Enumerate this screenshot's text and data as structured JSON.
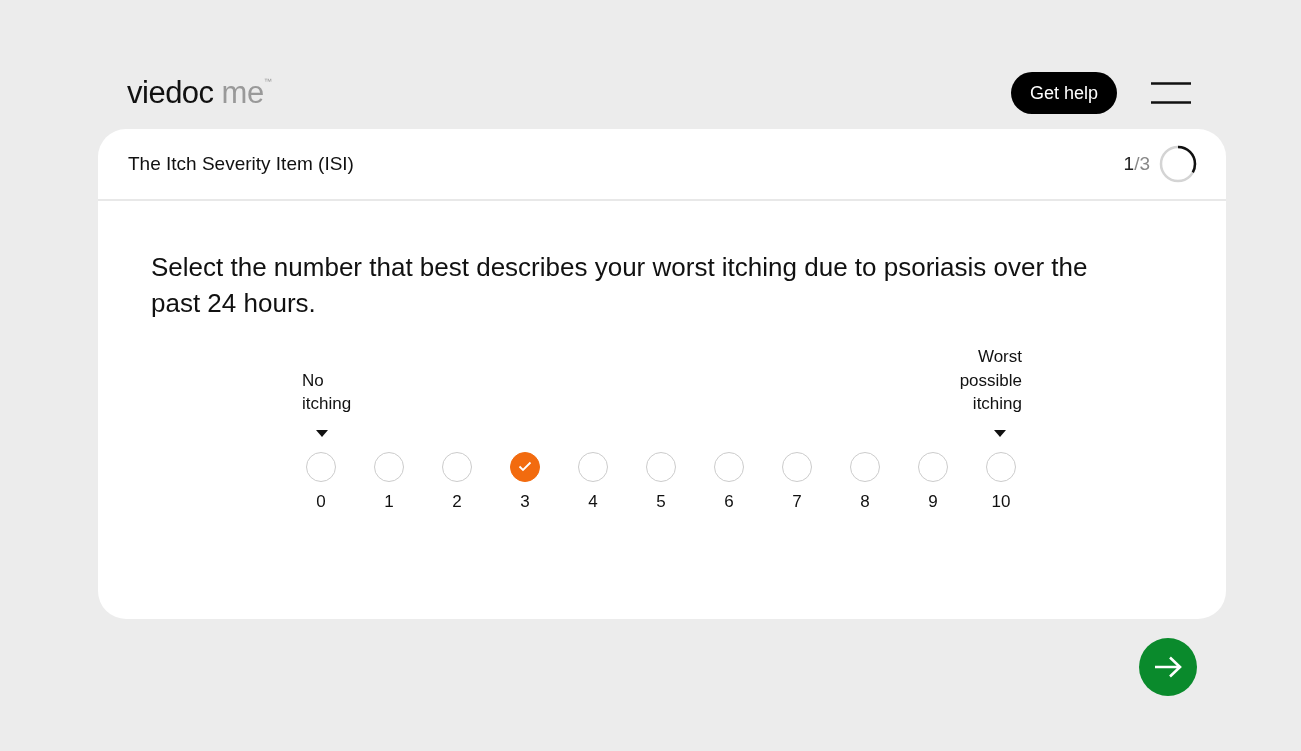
{
  "header": {
    "logo_main": "viedoc",
    "logo_sub": "me",
    "logo_mark": "™",
    "help_button": "Get help"
  },
  "card": {
    "title": "The Itch Severity Item (ISI)",
    "progress": {
      "current": "1",
      "total": "/3"
    }
  },
  "question": "Select the number that best describes your worst itching due to psoriasis over the past 24 hours.",
  "scale": {
    "low_label": "No itching",
    "high_label": "Worst possible itching",
    "options": [
      {
        "label": "0",
        "selected": false
      },
      {
        "label": "1",
        "selected": false
      },
      {
        "label": "2",
        "selected": false
      },
      {
        "label": "3",
        "selected": true
      },
      {
        "label": "4",
        "selected": false
      },
      {
        "label": "5",
        "selected": false
      },
      {
        "label": "6",
        "selected": false
      },
      {
        "label": "7",
        "selected": false
      },
      {
        "label": "8",
        "selected": false
      },
      {
        "label": "9",
        "selected": false
      },
      {
        "label": "10",
        "selected": false
      }
    ]
  }
}
